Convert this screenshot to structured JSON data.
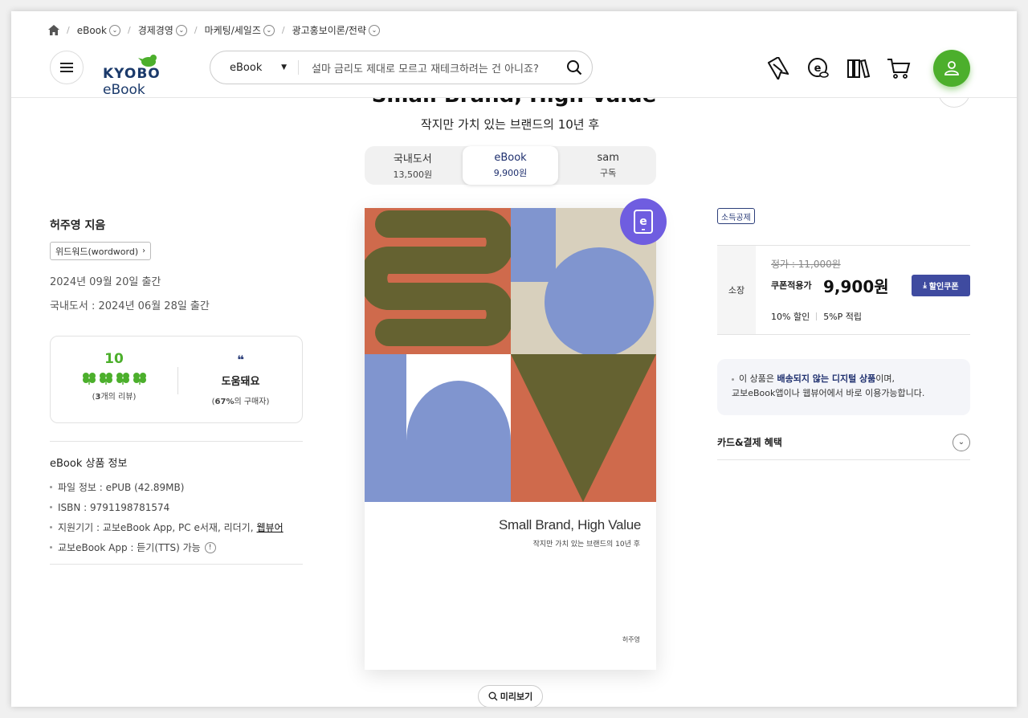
{
  "breadcrumb": [
    {
      "label": "eBook"
    },
    {
      "label": "경제경영"
    },
    {
      "label": "마케팅/세일즈"
    },
    {
      "label": "광고홍보이론/전략"
    }
  ],
  "logo": {
    "brand": "KYOBO",
    "suffix": "eBook"
  },
  "search": {
    "category": "eBook",
    "placeholder": "설마 금리도 제대로 모르고 재테크하려는 건 아니죠?"
  },
  "header_icons": [
    "bookmark-icon",
    "ebook-coin-icon",
    "library-icon",
    "cart-icon"
  ],
  "colors": {
    "accent_green": "#4caf2c",
    "brand_navy": "#1e2f6e",
    "ebadge_purple": "#6f5de0",
    "coupon_button": "#3f4ba0"
  },
  "product": {
    "title": "Small Brand, High Value",
    "subtitle": "작지만 가치 있는 브랜드의 10년 후",
    "format_tabs": [
      {
        "name": "국내도서",
        "price": "13,500원"
      },
      {
        "name": "eBook",
        "price": "9,900원"
      },
      {
        "name": "sam",
        "price": "구독"
      }
    ],
    "author": "허주영 지음",
    "publisher": "위드워드(wordword)",
    "publish_date": "2024년 09월 20일 출간",
    "print_date": "국내도서 : 2024년 06월 28일 출간"
  },
  "review": {
    "score": "10",
    "count_num": "3",
    "count_rest": "개의 리뷰)",
    "helpful_label": "도움돼요",
    "helpful_pct": "67%",
    "helpful_rest": "의 구매자)"
  },
  "ebook_info": {
    "title": "eBook 상품 정보",
    "file": "파일 정보 : ePUB (42.89MB)",
    "isbn": "ISBN : 9791198781574",
    "devices": "지원기기 : 교보eBook App, PC e서재, 리더기,",
    "devices_link": "웹뷰어",
    "tts": "교보eBook App : 듣기(TTS) 가능"
  },
  "cover": {
    "title": "Small Brand, High Value",
    "subtitle": "작지만 가치 있는 브랜드의 10년 후",
    "author": "허주영"
  },
  "preview_label": "미리보기",
  "pricing": {
    "tax_badge": "소득공제",
    "own_label": "소장",
    "original": "정가 : 11,000원",
    "coupon_label": "쿠폰적용가",
    "coupon_price": "9,900원",
    "coupon_button": "할인쿠폰",
    "discount": "10% 할인",
    "points": "5%P 적립"
  },
  "notice": {
    "part1": "이 상품은",
    "bold1": "배송되지 않는 디지털 상품",
    "part2": "이며,",
    "line2": "교보eBook앱이나 웹뷰어에서 바로 이용가능합니다."
  },
  "card_benefit_label": "카드&결제 혜택"
}
